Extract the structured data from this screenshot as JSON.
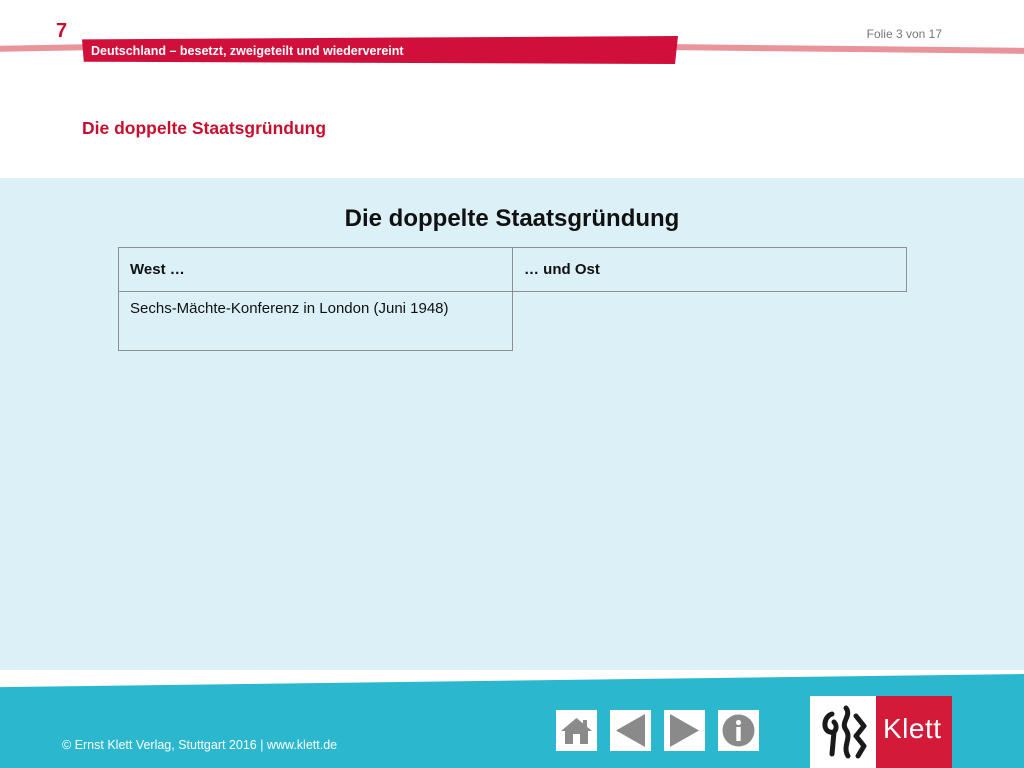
{
  "header": {
    "chapter_number": "7",
    "slide_counter": "Folie 3 von 17",
    "chapter_title": "Deutschland – besetzt, zweigeteilt und wiedervereint",
    "section_title": "Die doppelte Staatsgründung"
  },
  "main": {
    "title": "Die doppelte Staatsgründung",
    "table": {
      "columns": [
        "West …",
        "… und Ost"
      ],
      "rows": [
        [
          "Sechs-Mächte-Konferenz in London (Juni 1948)",
          ""
        ]
      ]
    }
  },
  "footer": {
    "copyright": "© Ernst Klett Verlag, Stuttgart 2016 | www.klett.de",
    "nav_buttons": [
      "home-icon",
      "arrow-left-icon",
      "arrow-right-icon",
      "info-icon"
    ],
    "logo_text": "Klett"
  },
  "colors": {
    "brand_red": "#d0103a",
    "content_background": "#dcf1f7",
    "footer_blue": "#2bb8cf",
    "icon_gray": "#8a8a8a"
  }
}
